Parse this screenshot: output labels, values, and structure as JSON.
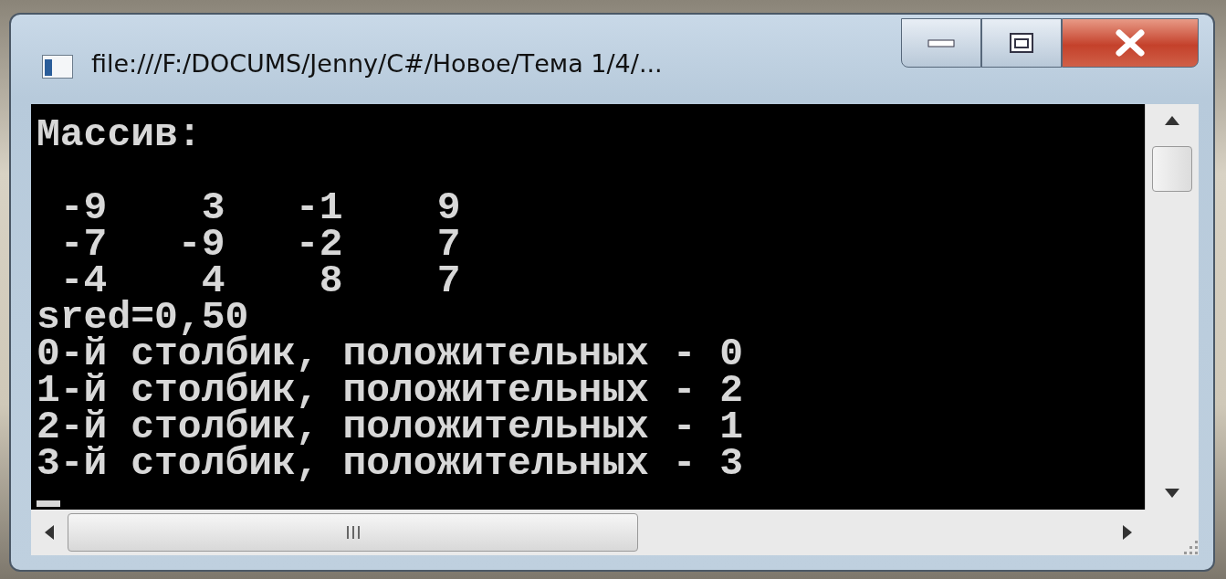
{
  "window": {
    "title": "file:///F:/DOCUMS/Jenny/C#/Новое/Тема 1/4/..."
  },
  "console": {
    "heading": "Массив:",
    "matrix_rows": [
      " -9    3   -1    9",
      " -7   -9   -2    7",
      " -4    4    8    7"
    ],
    "lines": [
      "sred=0,50",
      "0-й столбик, положительных - 0",
      "1-й столбик, положительных - 2",
      "2-й столбик, положительных - 1",
      "3-й столбик, положительных - 3"
    ]
  }
}
